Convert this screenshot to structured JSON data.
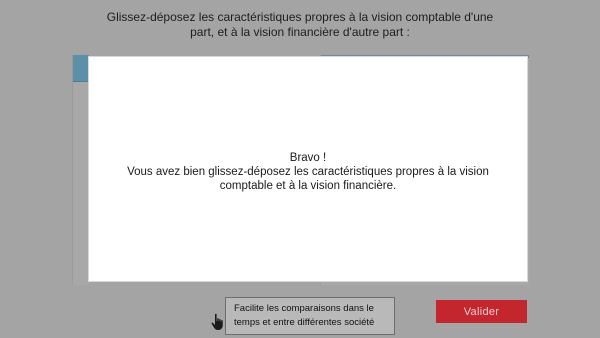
{
  "instruction": {
    "line1": "Glissez-déposez les caractéristiques propres à la vision comptable d'une",
    "line2": "part, et à la vision financière d'autre part :"
  },
  "modal": {
    "title": "Bravo !",
    "line1": "Vous avez bien glissez-déposez les caractéristiques propres à la vision",
    "line2": "comptable et à la vision financière."
  },
  "draggable_card": {
    "line1": "Facilite les comparaisons dans le",
    "line2": "temps et entre différentes société"
  },
  "validate_button": {
    "label": "Valider"
  },
  "colors": {
    "background": "#a4a4a4",
    "accent_button": "#c4262e",
    "zone_header": "#5e8fa9"
  },
  "icons": {
    "drag": "hand-pointer-icon"
  }
}
